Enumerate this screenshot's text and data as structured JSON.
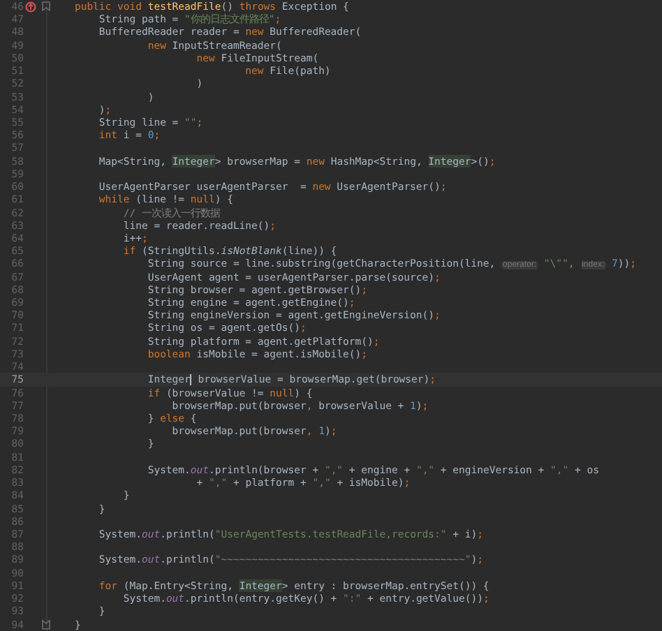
{
  "editor": {
    "lines": [
      {
        "number": "46",
        "current": false,
        "markers": [
          {
            "kind": "override"
          },
          {
            "kind": "fold-start"
          }
        ],
        "tokens": [
          {
            "text": "    public void ",
            "kind": "keyword"
          },
          {
            "text": "testReadFile",
            "kind": "method-declaration"
          },
          {
            "text": "() ",
            "kind": "plain"
          },
          {
            "text": "throws",
            "kind": "keyword"
          },
          {
            "text": " Exception {",
            "kind": "plain"
          }
        ]
      },
      {
        "number": "47",
        "current": false,
        "tokens": [
          {
            "text": "        String path = ",
            "kind": "plain"
          },
          {
            "text": "\"你的日志文件路径\"",
            "kind": "string"
          },
          {
            "text": ";",
            "kind": "keyword"
          }
        ]
      },
      {
        "number": "48",
        "current": false,
        "tokens": [
          {
            "text": "        BufferedReader reader = ",
            "kind": "plain"
          },
          {
            "text": "new",
            "kind": "keyword"
          },
          {
            "text": " BufferedReader(",
            "kind": "plain"
          }
        ]
      },
      {
        "number": "49",
        "current": false,
        "tokens": [
          {
            "text": "                new",
            "kind": "keyword"
          },
          {
            "text": " InputStreamReader(",
            "kind": "plain"
          }
        ]
      },
      {
        "number": "50",
        "current": false,
        "tokens": [
          {
            "text": "                        new",
            "kind": "keyword"
          },
          {
            "text": " FileInputStream(",
            "kind": "plain"
          }
        ]
      },
      {
        "number": "51",
        "current": false,
        "tokens": [
          {
            "text": "                                new",
            "kind": "keyword"
          },
          {
            "text": " File(path)",
            "kind": "plain"
          }
        ]
      },
      {
        "number": "52",
        "current": false,
        "tokens": [
          {
            "text": "                        )",
            "kind": "plain"
          }
        ]
      },
      {
        "number": "53",
        "current": false,
        "tokens": [
          {
            "text": "                )",
            "kind": "plain"
          }
        ]
      },
      {
        "number": "54",
        "current": false,
        "tokens": [
          {
            "text": "        )",
            "kind": "plain"
          },
          {
            "text": ";",
            "kind": "keyword"
          }
        ]
      },
      {
        "number": "55",
        "current": false,
        "tokens": [
          {
            "text": "        String line = ",
            "kind": "plain"
          },
          {
            "text": "\"\"",
            "kind": "string"
          },
          {
            "text": ";",
            "kind": "keyword"
          }
        ]
      },
      {
        "number": "56",
        "current": false,
        "tokens": [
          {
            "text": "        int",
            "kind": "keyword"
          },
          {
            "text": " i = ",
            "kind": "plain"
          },
          {
            "text": "0",
            "kind": "number"
          },
          {
            "text": ";",
            "kind": "keyword"
          }
        ]
      },
      {
        "number": "57",
        "current": false
      },
      {
        "number": "58",
        "current": false,
        "tokens": [
          {
            "text": "        Map<String, ",
            "kind": "plain"
          },
          {
            "text": "Integer",
            "kind": "type-highlight"
          },
          {
            "text": "> browserMap = ",
            "kind": "plain"
          },
          {
            "text": "new",
            "kind": "keyword"
          },
          {
            "text": " HashMap<String, ",
            "kind": "plain"
          },
          {
            "text": "Integer",
            "kind": "type-highlight"
          },
          {
            "text": ">()",
            "kind": "plain"
          },
          {
            "text": ";",
            "kind": "keyword"
          }
        ]
      },
      {
        "number": "59",
        "current": false
      },
      {
        "number": "60",
        "current": false,
        "tokens": [
          {
            "text": "        UserAgentParser userAgentParser  = ",
            "kind": "plain"
          },
          {
            "text": "new",
            "kind": "keyword"
          },
          {
            "text": " UserAgentParser()",
            "kind": "plain"
          },
          {
            "text": ";",
            "kind": "keyword"
          }
        ]
      },
      {
        "number": "61",
        "current": false,
        "tokens": [
          {
            "text": "        while",
            "kind": "keyword"
          },
          {
            "text": " (line != ",
            "kind": "plain"
          },
          {
            "text": "null",
            "kind": "keyword"
          },
          {
            "text": ") {",
            "kind": "plain"
          }
        ]
      },
      {
        "number": "62",
        "current": false,
        "tokens": [
          {
            "text": "            // 一次读入一行数据",
            "kind": "comment"
          }
        ]
      },
      {
        "number": "63",
        "current": false,
        "tokens": [
          {
            "text": "            line = reader.readLine()",
            "kind": "plain"
          },
          {
            "text": ";",
            "kind": "keyword"
          }
        ]
      },
      {
        "number": "64",
        "current": false,
        "tokens": [
          {
            "text": "            i++",
            "kind": "plain"
          },
          {
            "text": ";",
            "kind": "keyword"
          }
        ]
      },
      {
        "number": "65",
        "current": false,
        "tokens": [
          {
            "text": "            if",
            "kind": "keyword"
          },
          {
            "text": " (StringUtils.",
            "kind": "plain"
          },
          {
            "text": "isNotBlank",
            "kind": "static-call"
          },
          {
            "text": "(line)) {",
            "kind": "plain"
          }
        ]
      },
      {
        "number": "66",
        "current": false,
        "tokens": [
          {
            "text": "                String source = line.substring(getCharacterPosition(line, ",
            "kind": "plain"
          },
          {
            "text": "operator:",
            "kind": "hint"
          },
          {
            "text": " \"\\\"\"",
            "kind": "string"
          },
          {
            "text": ", ",
            "kind": "keyword"
          },
          {
            "text": "index:",
            "kind": "hint"
          },
          {
            "text": " 7",
            "kind": "number"
          },
          {
            "text": "))",
            "kind": "plain"
          },
          {
            "text": ";",
            "kind": "keyword"
          }
        ]
      },
      {
        "number": "67",
        "current": false,
        "tokens": [
          {
            "text": "                UserAgent agent = userAgentParser.parse(source)",
            "kind": "plain"
          },
          {
            "text": ";",
            "kind": "keyword"
          }
        ]
      },
      {
        "number": "68",
        "current": false,
        "tokens": [
          {
            "text": "                String browser = agent.getBrowser()",
            "kind": "plain"
          },
          {
            "text": ";",
            "kind": "keyword"
          }
        ]
      },
      {
        "number": "69",
        "current": false,
        "tokens": [
          {
            "text": "                String engine = agent.getEngine()",
            "kind": "plain"
          },
          {
            "text": ";",
            "kind": "keyword"
          }
        ]
      },
      {
        "number": "70",
        "current": false,
        "tokens": [
          {
            "text": "                String engineVersion = agent.getEngineVersion()",
            "kind": "plain"
          },
          {
            "text": ";",
            "kind": "keyword"
          }
        ]
      },
      {
        "number": "71",
        "current": false,
        "tokens": [
          {
            "text": "                String os = agent.getOs()",
            "kind": "plain"
          },
          {
            "text": ";",
            "kind": "keyword"
          }
        ]
      },
      {
        "number": "72",
        "current": false,
        "tokens": [
          {
            "text": "                String platform = agent.getPlatform()",
            "kind": "plain"
          },
          {
            "text": ";",
            "kind": "keyword"
          }
        ]
      },
      {
        "number": "73",
        "current": false,
        "tokens": [
          {
            "text": "                boolean",
            "kind": "keyword"
          },
          {
            "text": " isMobile = agent.isMobile()",
            "kind": "plain"
          },
          {
            "text": ";",
            "kind": "keyword"
          }
        ]
      },
      {
        "number": "74",
        "current": false
      },
      {
        "number": "75",
        "current": true,
        "tokens": [
          {
            "text": "                Integer",
            "kind": "plain"
          },
          {
            "kind": "caret"
          },
          {
            "text": " browserValue = browserMap.get(browser)",
            "kind": "plain"
          },
          {
            "text": ";",
            "kind": "keyword"
          }
        ]
      },
      {
        "number": "76",
        "current": false,
        "tokens": [
          {
            "text": "                if",
            "kind": "keyword"
          },
          {
            "text": " (browserValue != ",
            "kind": "plain"
          },
          {
            "text": "null",
            "kind": "keyword"
          },
          {
            "text": ") {",
            "kind": "plain"
          }
        ]
      },
      {
        "number": "77",
        "current": false,
        "tokens": [
          {
            "text": "                    browserMap.put(browser",
            "kind": "plain"
          },
          {
            "text": ",",
            "kind": "keyword"
          },
          {
            "text": " browserValue + ",
            "kind": "plain"
          },
          {
            "text": "1",
            "kind": "number"
          },
          {
            "text": ")",
            "kind": "plain"
          },
          {
            "text": ";",
            "kind": "keyword"
          }
        ]
      },
      {
        "number": "78",
        "current": false,
        "tokens": [
          {
            "text": "                } ",
            "kind": "plain"
          },
          {
            "text": "else",
            "kind": "keyword"
          },
          {
            "text": " {",
            "kind": "plain"
          }
        ]
      },
      {
        "number": "79",
        "current": false,
        "tokens": [
          {
            "text": "                    browserMap.put(browser",
            "kind": "plain"
          },
          {
            "text": ", ",
            "kind": "keyword"
          },
          {
            "text": "1",
            "kind": "number"
          },
          {
            "text": ")",
            "kind": "plain"
          },
          {
            "text": ";",
            "kind": "keyword"
          }
        ]
      },
      {
        "number": "80",
        "current": false,
        "tokens": [
          {
            "text": "                }",
            "kind": "plain"
          }
        ]
      },
      {
        "number": "81",
        "current": false
      },
      {
        "number": "82",
        "current": false,
        "tokens": [
          {
            "text": "                System.",
            "kind": "plain"
          },
          {
            "text": "out",
            "kind": "static-field"
          },
          {
            "text": ".println(browser + ",
            "kind": "plain"
          },
          {
            "text": "\",\"",
            "kind": "string"
          },
          {
            "text": " + engine + ",
            "kind": "plain"
          },
          {
            "text": "\",\"",
            "kind": "string"
          },
          {
            "text": " + engineVersion + ",
            "kind": "plain"
          },
          {
            "text": "\",\"",
            "kind": "string"
          },
          {
            "text": " + os",
            "kind": "plain"
          }
        ]
      },
      {
        "number": "83",
        "current": false,
        "tokens": [
          {
            "text": "                        + ",
            "kind": "plain"
          },
          {
            "text": "\",\"",
            "kind": "string"
          },
          {
            "text": " + platform + ",
            "kind": "plain"
          },
          {
            "text": "\",\"",
            "kind": "string"
          },
          {
            "text": " + isMobile)",
            "kind": "plain"
          },
          {
            "text": ";",
            "kind": "keyword"
          }
        ]
      },
      {
        "number": "84",
        "current": false,
        "tokens": [
          {
            "text": "            }",
            "kind": "plain"
          }
        ]
      },
      {
        "number": "85",
        "current": false,
        "tokens": [
          {
            "text": "        }",
            "kind": "plain"
          }
        ]
      },
      {
        "number": "86",
        "current": false
      },
      {
        "number": "87",
        "current": false,
        "tokens": [
          {
            "text": "        System.",
            "kind": "plain"
          },
          {
            "text": "out",
            "kind": "static-field"
          },
          {
            "text": ".println(",
            "kind": "plain"
          },
          {
            "text": "\"UserAgentTests.testReadFile,records:\"",
            "kind": "string"
          },
          {
            "text": " + i)",
            "kind": "plain"
          },
          {
            "text": ";",
            "kind": "keyword"
          }
        ]
      },
      {
        "number": "88",
        "current": false
      },
      {
        "number": "89",
        "current": false,
        "tokens": [
          {
            "text": "        System.",
            "kind": "plain"
          },
          {
            "text": "out",
            "kind": "static-field"
          },
          {
            "text": ".println(",
            "kind": "plain"
          },
          {
            "text": "\"~~~~~~~~~~~~~~~~~~~~~~~~~~~~~~~~~~~~~~~~\"",
            "kind": "string"
          },
          {
            "text": ")",
            "kind": "plain"
          },
          {
            "text": ";",
            "kind": "keyword"
          }
        ]
      },
      {
        "number": "90",
        "current": false
      },
      {
        "number": "91",
        "current": false,
        "tokens": [
          {
            "text": "        for",
            "kind": "keyword"
          },
          {
            "text": " (Map.Entry<String, ",
            "kind": "plain"
          },
          {
            "text": "Integer",
            "kind": "type-highlight"
          },
          {
            "text": "> entry : browserMap.entrySet()) {",
            "kind": "plain"
          }
        ]
      },
      {
        "number": "92",
        "current": false,
        "tokens": [
          {
            "text": "            System.",
            "kind": "plain"
          },
          {
            "text": "out",
            "kind": "static-field"
          },
          {
            "text": ".println(entry.getKey() + ",
            "kind": "plain"
          },
          {
            "text": "\":\"",
            "kind": "string"
          },
          {
            "text": " + entry.getValue())",
            "kind": "plain"
          },
          {
            "text": ";",
            "kind": "keyword"
          }
        ]
      },
      {
        "number": "93",
        "current": false,
        "tokens": [
          {
            "text": "        }",
            "kind": "plain"
          }
        ]
      },
      {
        "number": "94",
        "current": false,
        "markers": [
          {
            "kind": "fold-end"
          }
        ],
        "tokens": [
          {
            "text": "    }",
            "kind": "plain"
          }
        ]
      }
    ]
  }
}
